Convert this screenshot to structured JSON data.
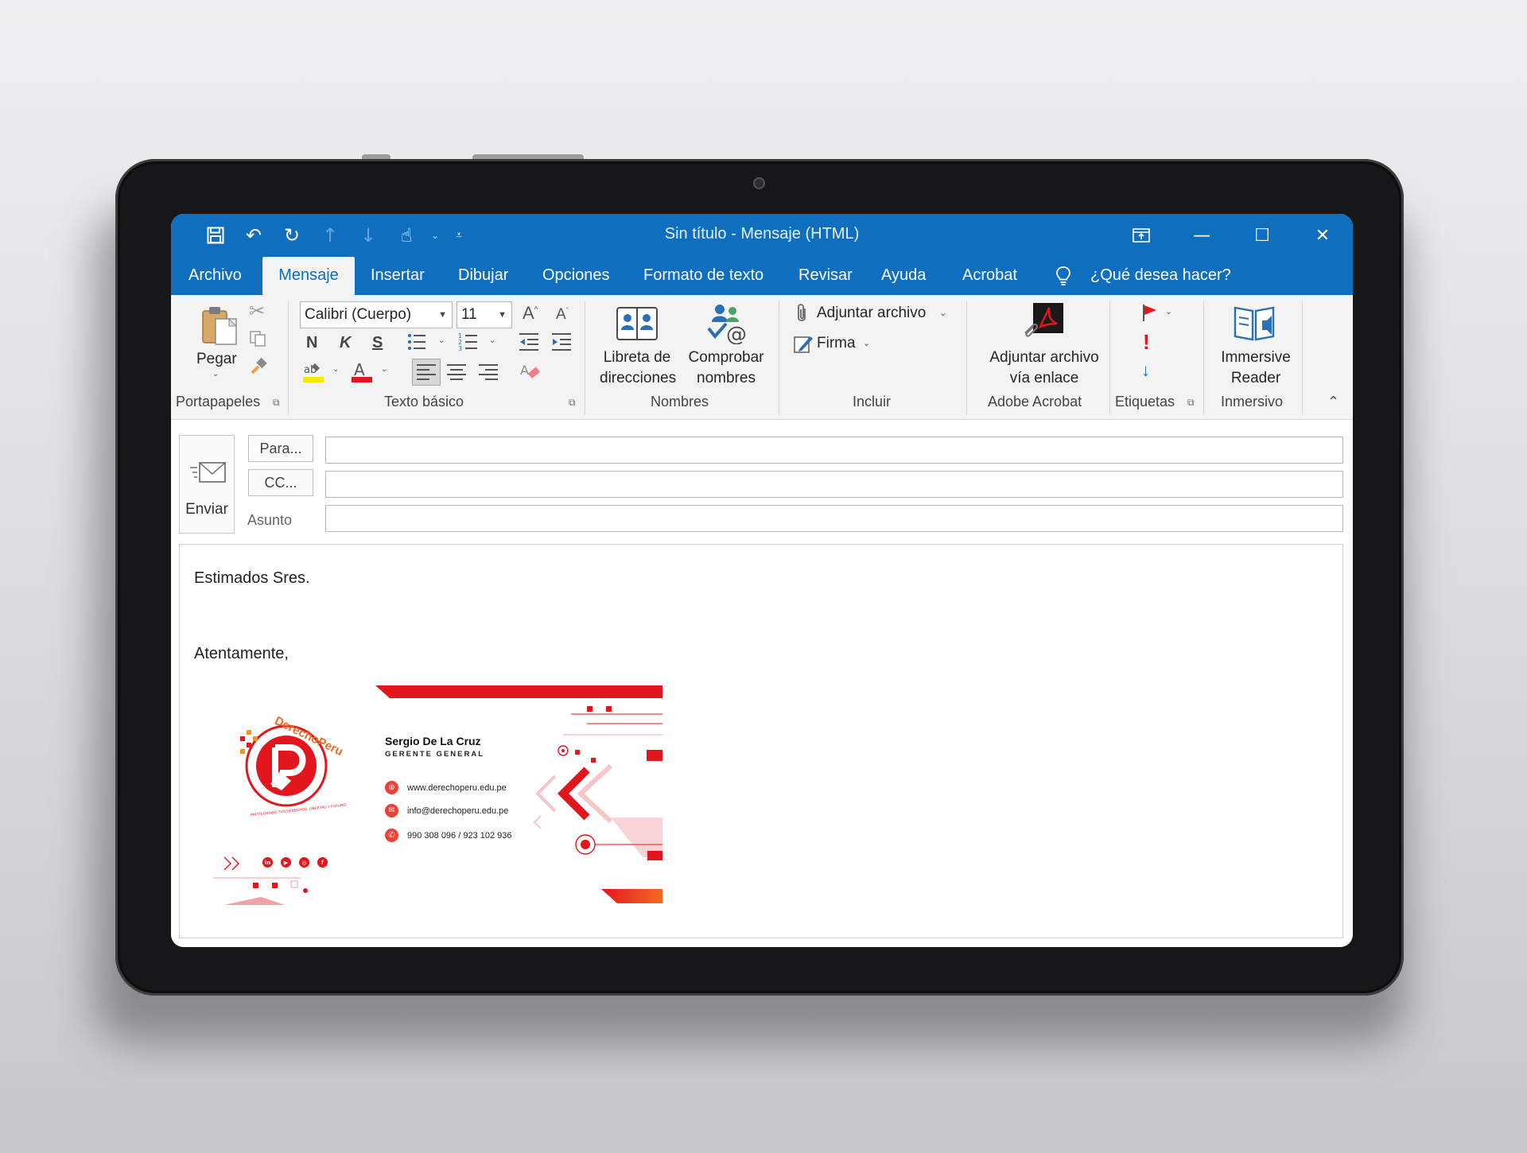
{
  "window": {
    "title": "Sin título  -  Mensaje (HTML)"
  },
  "tabs": [
    "Archivo",
    "Mensaje",
    "Insertar",
    "Dibujar",
    "Opciones",
    "Formato de texto",
    "Revisar",
    "Ayuda",
    "Acrobat"
  ],
  "active_tab": "Mensaje",
  "search": {
    "label": "¿Qué desea hacer?"
  },
  "ribbon": {
    "clipboard": {
      "paste_label": "Pegar",
      "group_label": "Portapapeles"
    },
    "basic_text": {
      "font_name": "Calibri (Cuerpo)",
      "font_size": "11",
      "bold": "N",
      "italic": "K",
      "underline": "S",
      "group_label": "Texto básico"
    },
    "names": {
      "address_book_line1": "Libreta de",
      "address_book_line2": "direcciones",
      "check_names_line1": "Comprobar",
      "check_names_line2": "nombres",
      "group_label": "Nombres"
    },
    "include": {
      "attach_file": "Adjuntar archivo",
      "signature": "Firma",
      "group_label": "Incluir"
    },
    "adobe": {
      "attach_link_line1": "Adjuntar archivo",
      "attach_link_line2": "vía enlace",
      "group_label": "Adobe Acrobat"
    },
    "tags": {
      "group_label": "Etiquetas"
    },
    "immersive": {
      "reader_line1": "Immersive",
      "reader_line2": "Reader",
      "group_label": "Inmersivo"
    }
  },
  "compose": {
    "send_label": "Enviar",
    "to_label": "Para...",
    "cc_label": "CC...",
    "subject_label": "Asunto",
    "to_value": "",
    "cc_value": "",
    "subject_value": "",
    "body_line1": "Estimados Sres.",
    "body_line2": "Atentamente,"
  },
  "signature": {
    "logo_text": "DerechoPeru",
    "logo_tagline": "PROTEGIENDO TUS DERECHOS, LIBERTAD Y FUTURO",
    "name": "Sergio De La Cruz",
    "role": "GERENTE GENERAL",
    "website": "www.derechoperu.edu.pe",
    "email": "info@derechoperu.edu.pe",
    "phone": "990 308 096  /  923 102 936"
  },
  "colors": {
    "title_bar": "#106ebe",
    "ribbon": "#f3f3f3",
    "brand_red": "#e3161e",
    "brand_orange": "#f7941d"
  }
}
